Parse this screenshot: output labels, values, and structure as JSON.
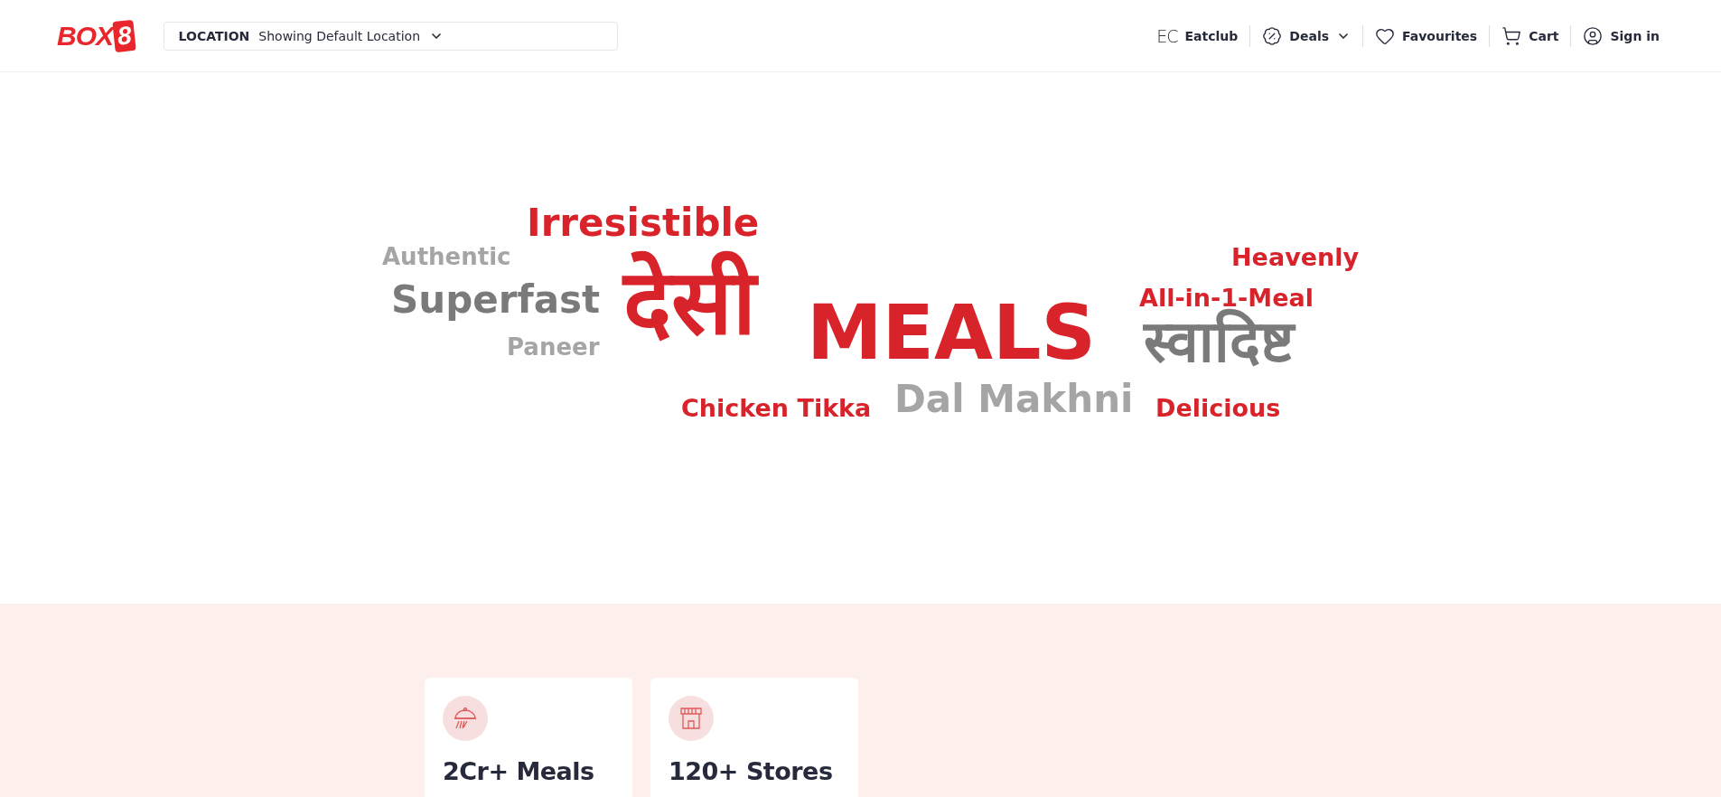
{
  "header": {
    "logo": {
      "text": "BOX",
      "badge": "8"
    },
    "location": {
      "label": "LOCATION",
      "value": "Showing Default Location"
    },
    "nav": [
      {
        "kind": "eatclub",
        "mark": "EC",
        "label": "Eatclub"
      },
      {
        "kind": "deals",
        "label": "Deals"
      },
      {
        "kind": "favourites",
        "label": "Favourites"
      },
      {
        "kind": "cart",
        "label": "Cart"
      },
      {
        "kind": "signin",
        "label": "Sign in"
      }
    ]
  },
  "hero": {
    "words": [
      {
        "text": "Irresistible",
        "color": "#d9232b"
      },
      {
        "text": "Authentic",
        "color": "#a5a5a5"
      },
      {
        "text": "Heavenly",
        "color": "#d9232b"
      },
      {
        "text": "Superfast",
        "color": "#7a7a7a"
      },
      {
        "text": "देसी",
        "color": "#d9232b"
      },
      {
        "text": "MEALS",
        "color": "#d9232b"
      },
      {
        "text": "All-in-1-Meal",
        "color": "#d9232b"
      },
      {
        "text": "Paneer",
        "color": "#a5a5a5"
      },
      {
        "text": "स्वादिष्ट",
        "color": "#7a7a7a"
      },
      {
        "text": "Chicken Tikka",
        "color": "#d9232b"
      },
      {
        "text": "Dal Makhni",
        "color": "#a5a5a5"
      },
      {
        "text": "Delicious",
        "color": "#d9232b"
      }
    ]
  },
  "stats": [
    {
      "kind": "meals",
      "title": "2Cr+ Meals"
    },
    {
      "kind": "stores",
      "title": "120+ Stores"
    }
  ]
}
